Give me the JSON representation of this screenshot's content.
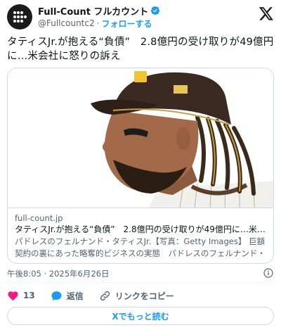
{
  "header": {
    "display_name": "Full-Count フルカウント",
    "handle": "@Fullcountc2",
    "separator": "·",
    "follow_label": "フォローする"
  },
  "tweet": {
    "text": "タティスJr.が抱える“負債”　2.8億円の受け取りが49億円に…米会社に怒りの訴え"
  },
  "card": {
    "domain": "full-count.jp",
    "title": "タティスJr.が抱える“負債”　2.8億円の受け取りが49億円に…米会社に怒…",
    "description": "パドレスのフェルナンド・タティスJr.【写真：Getty Images】 巨額契約の裏にあった略奪的ビジネスの実態　パドレスのフェルナンド・タティ…"
  },
  "meta": {
    "timestamp": "午後8:05 · 2025年6月26日"
  },
  "actions": {
    "like_count": "13",
    "reply_label": "返信",
    "copy_link_label": "リンクをコピー"
  },
  "read_more": {
    "label": "Xでもっと読む"
  },
  "colors": {
    "accent": "#1d9bf0",
    "like": "#f91880",
    "secondary_text": "#536471",
    "border": "#cfd9de"
  },
  "icons": [
    "fullcount-logo-icon",
    "verified-badge-icon",
    "x-logo-icon",
    "info-icon",
    "heart-icon",
    "reply-icon",
    "link-icon"
  ]
}
